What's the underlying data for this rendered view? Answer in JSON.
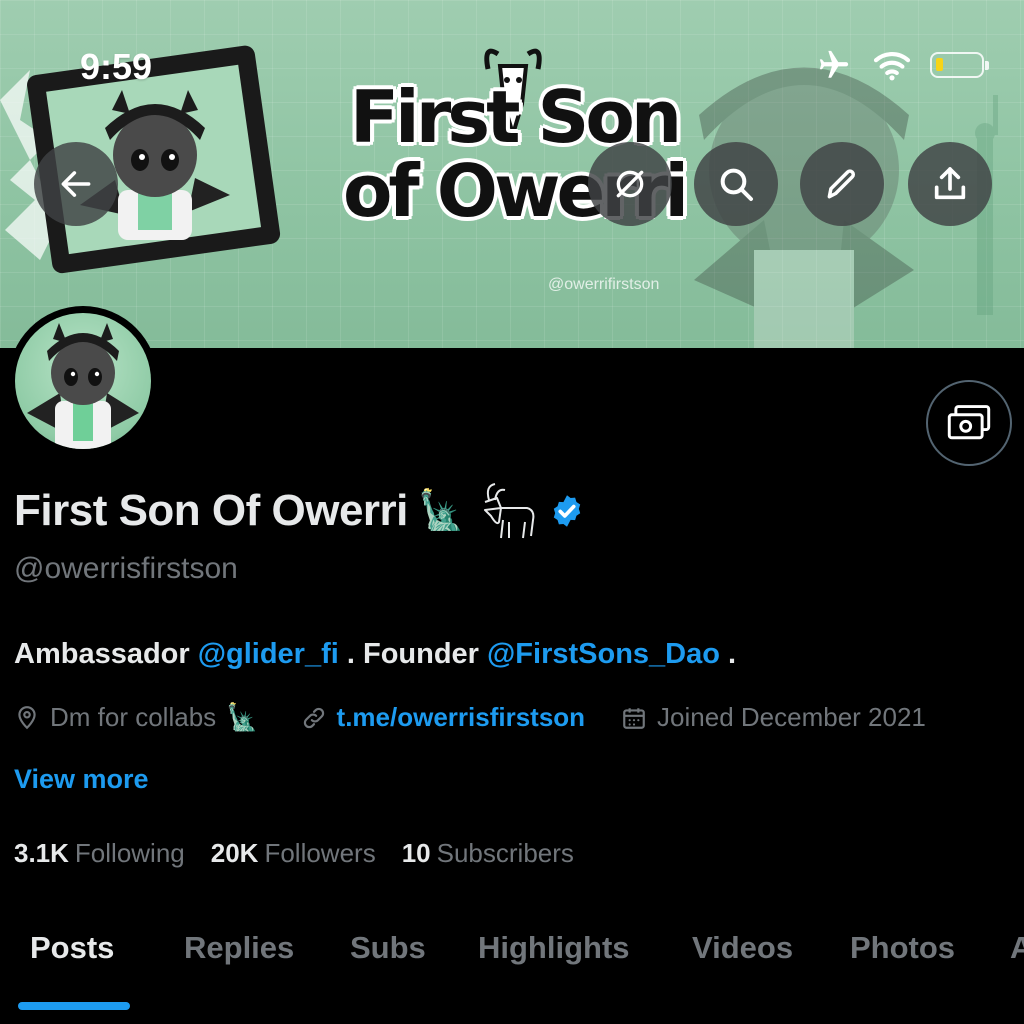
{
  "status_bar": {
    "time": "9:59"
  },
  "banner": {
    "title_line1": "First Son",
    "title_line2": "of Owerri",
    "handle_watermark": "@owerrifirstson"
  },
  "profile": {
    "display_name": "First Son Of Owerri",
    "name_emojis": "🗽",
    "handle": "@owerrisfirstson",
    "bio": {
      "part1": "Ambassador ",
      "mention1": "@glider_fi",
      "part2": " . Founder ",
      "mention2": "@FirstSons_Dao",
      "part3": " ."
    },
    "location": "Dm for collabs",
    "location_emoji": "🗽",
    "website": "t.me/owerrisfirstson",
    "joined": "Joined December 2021",
    "view_more": "View more",
    "stats": {
      "following_count": "3.1K",
      "following_label": "Following",
      "followers_count": "20K",
      "followers_label": "Followers",
      "subscribers_count": "10",
      "subscribers_label": "Subscribers"
    }
  },
  "tabs": [
    {
      "label": "Posts",
      "active": true
    },
    {
      "label": "Replies",
      "active": false
    },
    {
      "label": "Subs",
      "active": false
    },
    {
      "label": "Highlights",
      "active": false
    },
    {
      "label": "Videos",
      "active": false
    },
    {
      "label": "Photos",
      "active": false
    },
    {
      "label": "A",
      "active": false
    }
  ],
  "icons": {
    "back": "back-arrow-icon",
    "grok": "grok-icon",
    "search": "search-icon",
    "edit": "pencil-icon",
    "share": "share-icon",
    "subscribe": "money-icon",
    "verified": "verified-badge-icon",
    "location": "location-pin-icon",
    "link": "link-icon",
    "calendar": "calendar-icon"
  },
  "colors": {
    "accent": "#1d9bf0",
    "muted": "#71767b",
    "text": "#e7e9ea",
    "background": "#000000",
    "banner_green": "#8fc4a3",
    "battery_low": "#f7d417"
  }
}
